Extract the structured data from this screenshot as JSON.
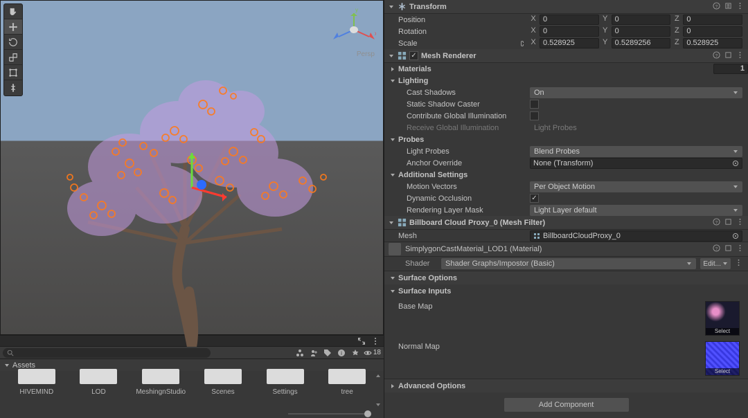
{
  "transform": {
    "title": "Transform",
    "position": {
      "label": "Position",
      "x": "0",
      "y": "0",
      "z": "0"
    },
    "rotation": {
      "label": "Rotation",
      "x": "0",
      "y": "0",
      "z": "0"
    },
    "scale": {
      "label": "Scale",
      "x": "0.528925",
      "y": "0.5289256",
      "z": "0.528925"
    }
  },
  "axes": {
    "x": "X",
    "y": "Y",
    "z": "Z"
  },
  "mesh_renderer": {
    "title": "Mesh Renderer",
    "materials": {
      "label": "Materials",
      "count": "1"
    },
    "lighting": {
      "label": "Lighting",
      "cast_shadows": {
        "label": "Cast Shadows",
        "value": "On"
      },
      "static_shadow_caster": {
        "label": "Static Shadow Caster",
        "checked": false
      },
      "contribute_gi": {
        "label": "Contribute Global Illumination",
        "checked": false
      },
      "receive_gi": {
        "label": "Receive Global Illumination",
        "value": "Light Probes"
      }
    },
    "probes": {
      "label": "Probes",
      "light_probes": {
        "label": "Light Probes",
        "value": "Blend Probes"
      },
      "anchor_override": {
        "label": "Anchor Override",
        "value": "None (Transform)"
      }
    },
    "additional": {
      "label": "Additional Settings",
      "motion_vectors": {
        "label": "Motion Vectors",
        "value": "Per Object Motion"
      },
      "dynamic_occlusion": {
        "label": "Dynamic Occlusion",
        "checked": true
      },
      "rendering_layer_mask": {
        "label": "Rendering Layer Mask",
        "value": "Light Layer default"
      }
    }
  },
  "mesh_filter": {
    "title": "Billboard Cloud Proxy_0 (Mesh Filter)",
    "mesh": {
      "label": "Mesh",
      "value": "BillboardCloudProxy_0"
    }
  },
  "material": {
    "title": "SimplygonCastMaterial_LOD1 (Material)",
    "shader_label": "Shader",
    "shader_value": "Shader Graphs/Impostor (Basic)",
    "edit_label": "Edit..."
  },
  "surface": {
    "options_label": "Surface Options",
    "inputs_label": "Surface Inputs",
    "base_map_label": "Base Map",
    "normal_map_label": "Normal Map",
    "select_label": "Select"
  },
  "advanced": {
    "label": "Advanced Options"
  },
  "add_component_label": "Add Component",
  "scene": {
    "persp_label": "Persp",
    "visible_count": "18"
  },
  "assets": {
    "header": "Assets",
    "items": [
      "HIVEMIND",
      "LOD",
      "MeshingnStudio",
      "Scenes",
      "Settings",
      "tree"
    ]
  }
}
